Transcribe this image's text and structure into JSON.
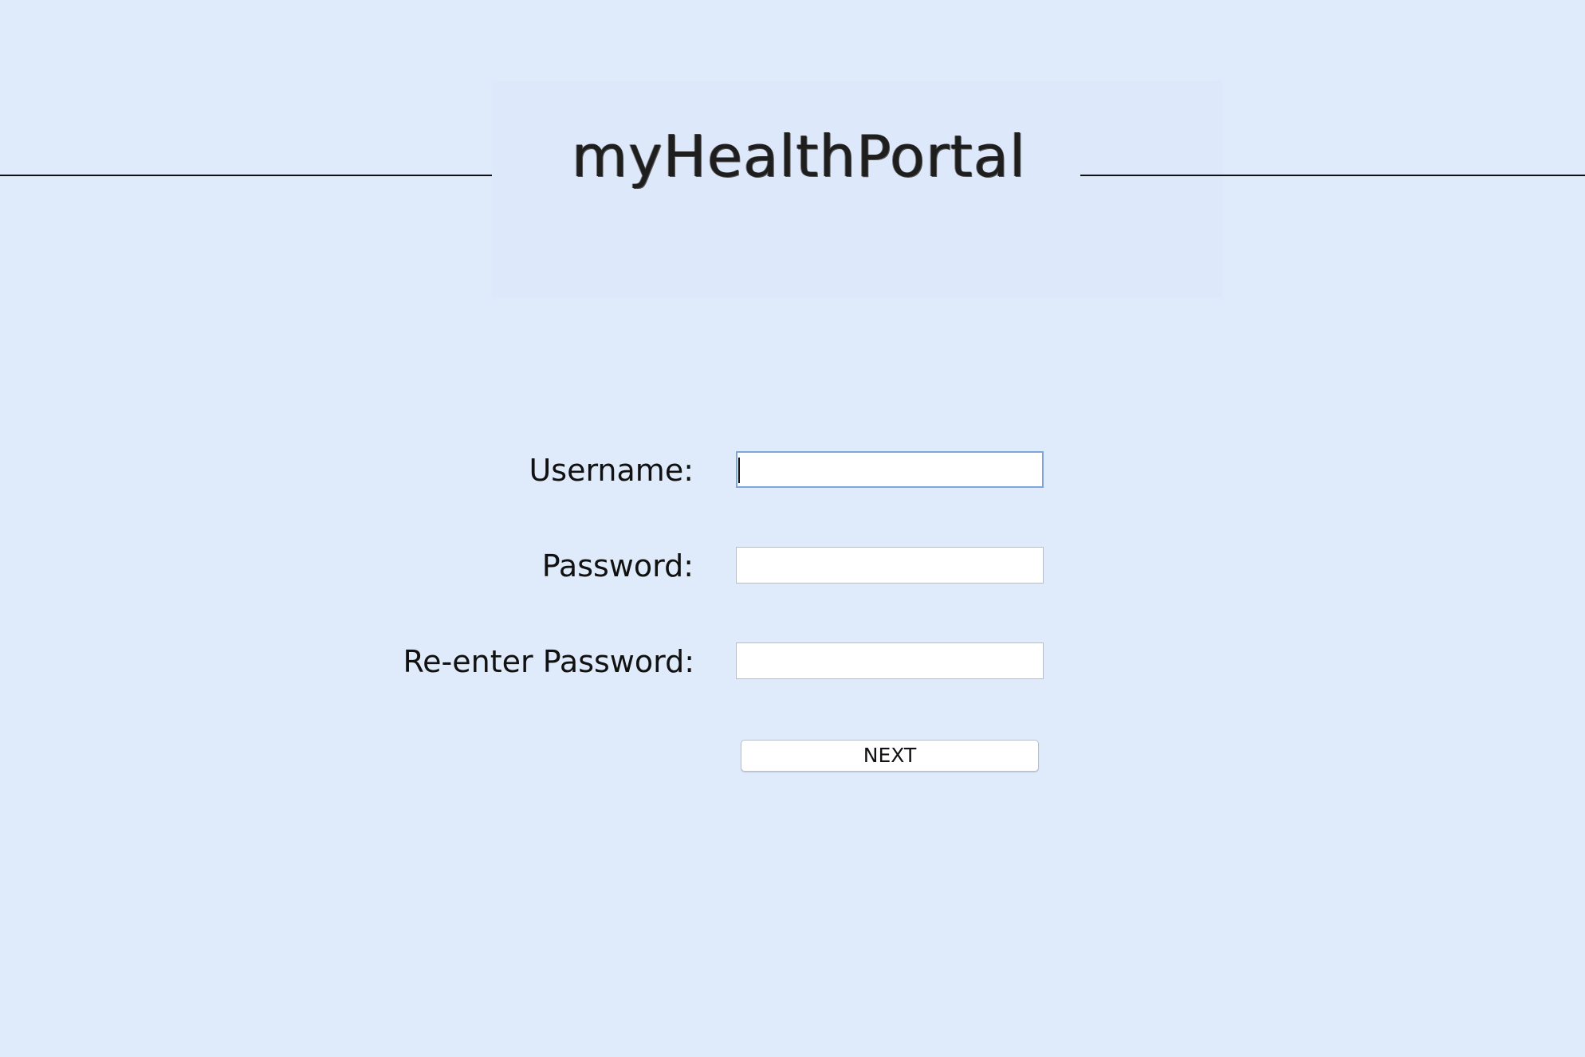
{
  "header": {
    "logo_text": "myHealthPortal"
  },
  "form": {
    "username_label": "Username:",
    "username_value": "",
    "password_label": "Password:",
    "password_value": "",
    "reenter_label": "Re-enter Password:",
    "reenter_value": "",
    "next_label": "NEXT"
  },
  "colors": {
    "background": "#dfebfb",
    "input_focus_border": "#7fa6dc"
  }
}
